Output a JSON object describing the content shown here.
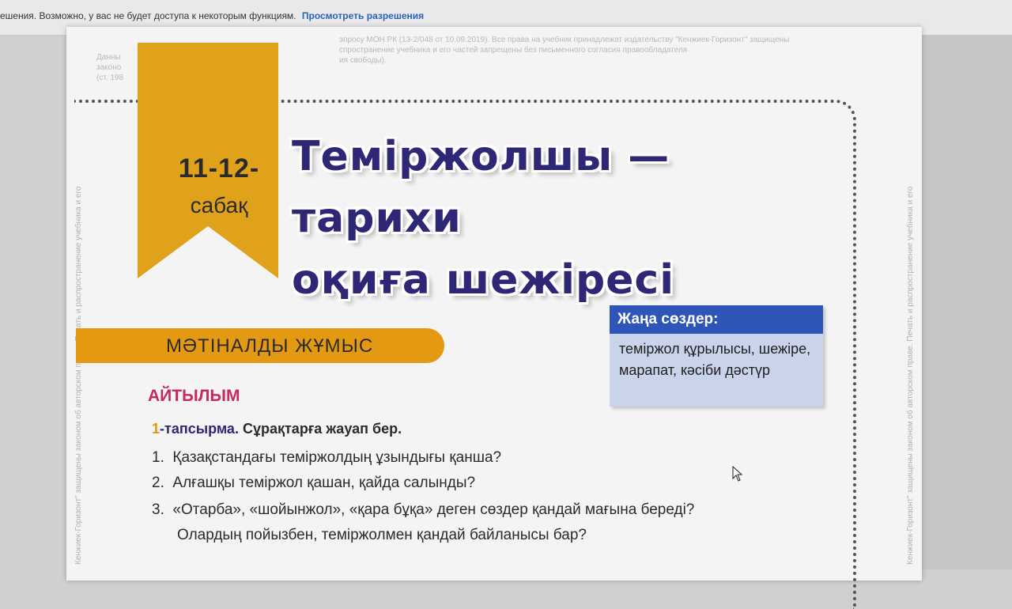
{
  "infobar": {
    "message": "ешения. Возможно, у вас не будет доступа к некоторым функциям.",
    "link": "Просмотреть разрешения"
  },
  "copyright": {
    "top_line_1": "эпросу МОН РК (13-2/048 от 10.09.2019). Все права на учебник принадлежат издательству \"Кенжиек-Горизонт\" защищены",
    "top_line_2": "спространение учебника и его частей запрещены без письменного согласия правообладателя",
    "top_line_3": "ия свободы).",
    "left_line_1": "Данны",
    "left_line_2": "законо",
    "left_line_3": "(ст. 198",
    "vertical_left": "Кенжиек-Горизонт\" защищены законом об авторском праве. Печать и распространение учебника и его",
    "vertical_right": "Кенжиек-Горизонт\" защищены законом об авторском праве. Печать и распространение учебника и его"
  },
  "lesson": {
    "number": "11-12-",
    "word": "сабақ",
    "title_line_1": "Теміржолшы — тарихи",
    "title_line_2": "оқиға шежіресі"
  },
  "section": {
    "label": "МӘТІНАЛДЫ ЖҰМЫС"
  },
  "new_words": {
    "heading": "Жаңа сөздер:",
    "content": "теміржол құрылысы, шежіре, марапат, кәсіби дәстүр"
  },
  "speaking": {
    "label": "АЙТЫЛЫМ"
  },
  "task": {
    "number": "1",
    "label": "-тапсырма.",
    "instruction": "Сұрақтарға жауап бер."
  },
  "questions": [
    {
      "n": "1.",
      "text": "Қазақстандағы теміржолдың ұзындығы қанша?"
    },
    {
      "n": "2.",
      "text": "Алғашқы теміржол қашан, қайда салынды?"
    },
    {
      "n": "3.",
      "text": "«Отарба», «шойынжол», «қара бұқа» деген сөздер қандай мағына береді?"
    }
  ],
  "question_3_continuation": "Олардың пойызбен, теміржолмен қандай байланысы бар?",
  "colors": {
    "ribbon": "#e0a21a",
    "section_bar": "#e39a12",
    "title": "#2d2776",
    "speech": "#c52a5a",
    "new_words_header": "#2f55b8",
    "new_words_body": "#c9d3ea"
  }
}
